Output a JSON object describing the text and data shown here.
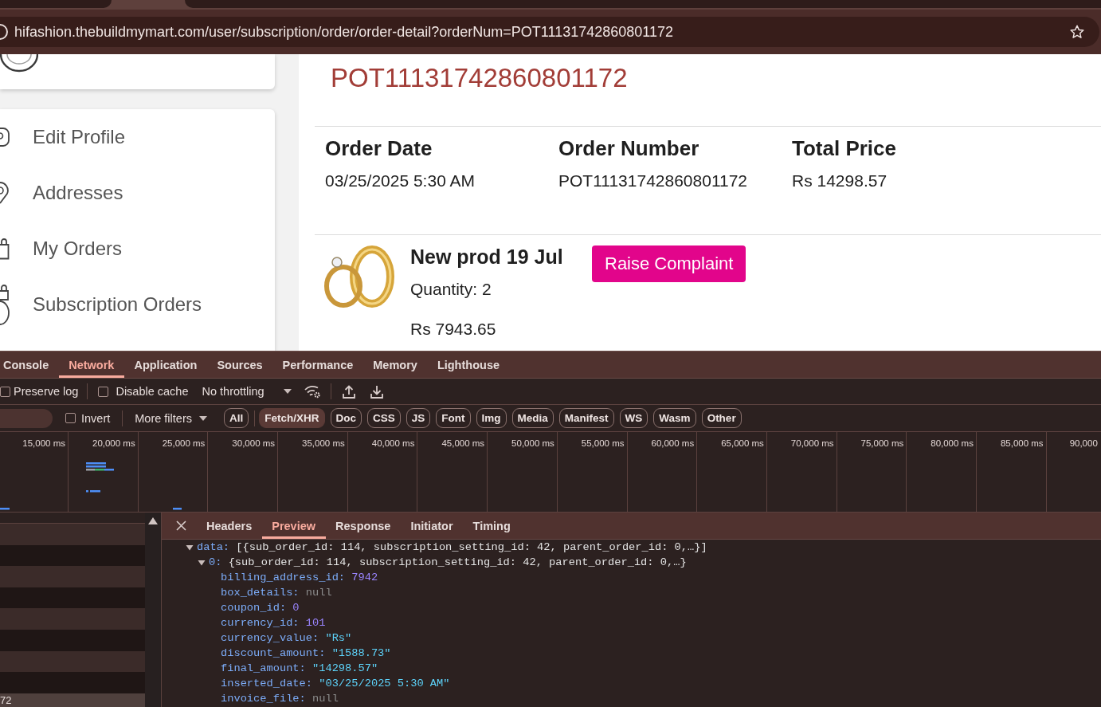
{
  "browser": {
    "url": "hifashion.thebuildmymart.com/user/subscription/order/order-detail?orderNum=POT11131742860801172"
  },
  "sidebar": {
    "items": [
      {
        "label": "Edit Profile",
        "selected": false
      },
      {
        "label": "Addresses",
        "selected": false
      },
      {
        "label": "My Orders",
        "selected": false
      },
      {
        "label": "Subscription Orders",
        "selected": false
      }
    ]
  },
  "order": {
    "number": "POT11131742860801172",
    "fields": [
      {
        "label": "Order Date",
        "value": "03/25/2025 5:30 AM"
      },
      {
        "label": "Order Number",
        "value": "POT11131742860801172"
      },
      {
        "label": "Total Price",
        "value": "Rs 14298.57"
      }
    ],
    "items": [
      {
        "name": "New prod 19 Jul",
        "quantity": "Quantity: 2",
        "price": "Rs 7943.65",
        "action": "Raise Complaint"
      }
    ]
  },
  "devtools": {
    "tabs": [
      {
        "label": "Console",
        "selected": false
      },
      {
        "label": "Network",
        "selected": true
      },
      {
        "label": "Application",
        "selected": false
      },
      {
        "label": "Sources",
        "selected": false
      },
      {
        "label": "Performance",
        "selected": false
      },
      {
        "label": "Memory",
        "selected": false
      },
      {
        "label": "Lighthouse",
        "selected": false
      }
    ],
    "toolbar": {
      "preserve_log": {
        "label": "Preserve log",
        "checked": false
      },
      "disable_cache": {
        "label": "Disable cache",
        "checked": false
      },
      "throttling": "No throttling"
    },
    "filters": {
      "invert": {
        "label": "Invert",
        "checked": false
      },
      "more_filters": "More filters",
      "types": [
        {
          "label": "All",
          "selected": false
        },
        {
          "label": "Fetch/XHR",
          "selected": true
        },
        {
          "label": "Doc",
          "selected": false
        },
        {
          "label": "CSS",
          "selected": false
        },
        {
          "label": "JS",
          "selected": false
        },
        {
          "label": "Font",
          "selected": false
        },
        {
          "label": "Img",
          "selected": false
        },
        {
          "label": "Media",
          "selected": false
        },
        {
          "label": "Manifest",
          "selected": false
        },
        {
          "label": "WS",
          "selected": false
        },
        {
          "label": "Wasm",
          "selected": false
        },
        {
          "label": "Other",
          "selected": false
        }
      ]
    },
    "overview": {
      "ticks": [
        "15,000 ms",
        "20,000 ms",
        "25,000 ms",
        "30,000 ms",
        "35,000 ms",
        "40,000 ms",
        "45,000 ms",
        "50,000 ms",
        "55,000 ms",
        "60,000 ms",
        "65,000 ms",
        "70,000 ms",
        "75,000 ms",
        "80,000 ms",
        "85,000 ms",
        "90,000"
      ]
    },
    "requests": [
      {
        "selected": false
      },
      {
        "selected": false
      },
      {
        "selected": false
      },
      {
        "selected": false
      },
      {
        "selected": false
      },
      {
        "selected": false
      },
      {
        "selected": false
      },
      {
        "selected": false
      },
      {
        "name": "72",
        "selected": true
      }
    ],
    "detail_tabs": [
      {
        "label": "Headers",
        "selected": false
      },
      {
        "label": "Preview",
        "selected": true
      },
      {
        "label": "Response",
        "selected": false
      },
      {
        "label": "Initiator",
        "selected": false
      },
      {
        "label": "Timing",
        "selected": false
      }
    ],
    "preview": [
      {
        "key": "data:",
        "summary": "[{sub_order_id: 114, subscription_setting_id: 42, parent_order_id: 0,…}]",
        "expanded": true,
        "children": [
          {
            "key": "0:",
            "summary": "{sub_order_id: 114, subscription_setting_id: 42, parent_order_id: 0,…}",
            "expanded": true,
            "children": [
              {
                "key": "billing_address_id:",
                "value": "7942",
                "kind": "number"
              },
              {
                "key": "box_details:",
                "value": "null",
                "kind": "null"
              },
              {
                "key": "coupon_id:",
                "value": "0",
                "kind": "number"
              },
              {
                "key": "currency_id:",
                "value": "101",
                "kind": "number"
              },
              {
                "key": "currency_value:",
                "value": "\"Rs\"",
                "kind": "string"
              },
              {
                "key": "discount_amount:",
                "value": "\"1588.73\"",
                "kind": "string"
              },
              {
                "key": "final_amount:",
                "value": "\"14298.57\"",
                "kind": "string"
              },
              {
                "key": "inserted_date:",
                "value": "\"03/25/2025 5:30 AM\"",
                "kind": "string"
              },
              {
                "key": "invoice_file:",
                "value": "null",
                "kind": "null"
              }
            ]
          }
        ]
      }
    ]
  }
}
